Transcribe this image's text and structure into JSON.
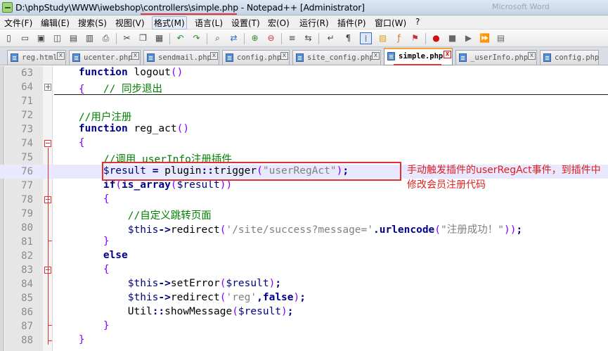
{
  "window": {
    "title": "D:\\phpStudy\\WWW\\iwebshop\\controllers\\simple.php - Notepad++ [Administrator]",
    "faded_text": "Microsoft Word"
  },
  "menu": {
    "items": [
      "文件(F)",
      "编辑(E)",
      "搜索(S)",
      "视图(V)",
      "格式(M)",
      "语言(L)",
      "设置(T)",
      "宏(O)",
      "运行(R)",
      "插件(P)",
      "窗口(W)",
      "?"
    ]
  },
  "toolbar": {
    "icons": [
      "new-file-icon",
      "open-file-icon",
      "save-icon",
      "save-all-icon",
      "close-icon",
      "close-all-icon",
      "print-icon",
      "cut-icon",
      "copy-icon",
      "paste-icon",
      "undo-icon",
      "redo-icon",
      "find-icon",
      "replace-icon",
      "zoom-in-icon",
      "zoom-out-icon",
      "sync-vertical-icon",
      "sync-horizontal-icon",
      "word-wrap-icon",
      "show-all-chars-icon",
      "indent-guide-icon",
      "doc-map-icon",
      "function-list-icon",
      "folder-workspace-icon",
      "record-macro-icon",
      "stop-record-icon",
      "play-macro-icon",
      "run-macro-multiple-icon",
      "save-macro-icon"
    ]
  },
  "tabs": [
    {
      "label": "reg.html"
    },
    {
      "label": "ucenter.php"
    },
    {
      "label": "sendmail.php"
    },
    {
      "label": "config.php"
    },
    {
      "label": "site_config.php"
    },
    {
      "label": "simple.php"
    },
    {
      "label": "_userInfo.php"
    },
    {
      "label": "config.php"
    }
  ],
  "editor": {
    "lines": [
      {
        "num": "63",
        "code": "    function logout()"
      },
      {
        "num": "64",
        "code": "    {   // 同步退出"
      },
      {
        "num": "71",
        "code": ""
      },
      {
        "num": "72",
        "code": "    //用户注册"
      },
      {
        "num": "73",
        "code": "    function reg_act()"
      },
      {
        "num": "74",
        "code": "    {"
      },
      {
        "num": "75",
        "code": "        //调用_userInfo注册插件"
      },
      {
        "num": "76",
        "code": "        $result = plugin::trigger(\"userRegAct\");"
      },
      {
        "num": "77",
        "code": "        if(is_array($result))"
      },
      {
        "num": "78",
        "code": "        {"
      },
      {
        "num": "79",
        "code": "            //自定义跳转页面"
      },
      {
        "num": "80",
        "code": "            $this->redirect('/site/success?message='.urlencode(\"注册成功！\"));"
      },
      {
        "num": "81",
        "code": "        }"
      },
      {
        "num": "82",
        "code": "        else"
      },
      {
        "num": "83",
        "code": "        {"
      },
      {
        "num": "84",
        "code": "            $this->setError($result);"
      },
      {
        "num": "85",
        "code": "            $this->redirect('reg',false);"
      },
      {
        "num": "86",
        "code": "            Util::showMessage($result);"
      },
      {
        "num": "87",
        "code": "        }"
      },
      {
        "num": "88",
        "code": "    }"
      }
    ]
  },
  "annotation": {
    "text": "手动触发插件的userRegAct事件，到插件中修改会员注册代码"
  },
  "colors": {
    "keyword": "#00008b",
    "comment": "#008000",
    "string": "#808080",
    "annotation": "#e02020",
    "current_line": "#e8e8ff"
  }
}
